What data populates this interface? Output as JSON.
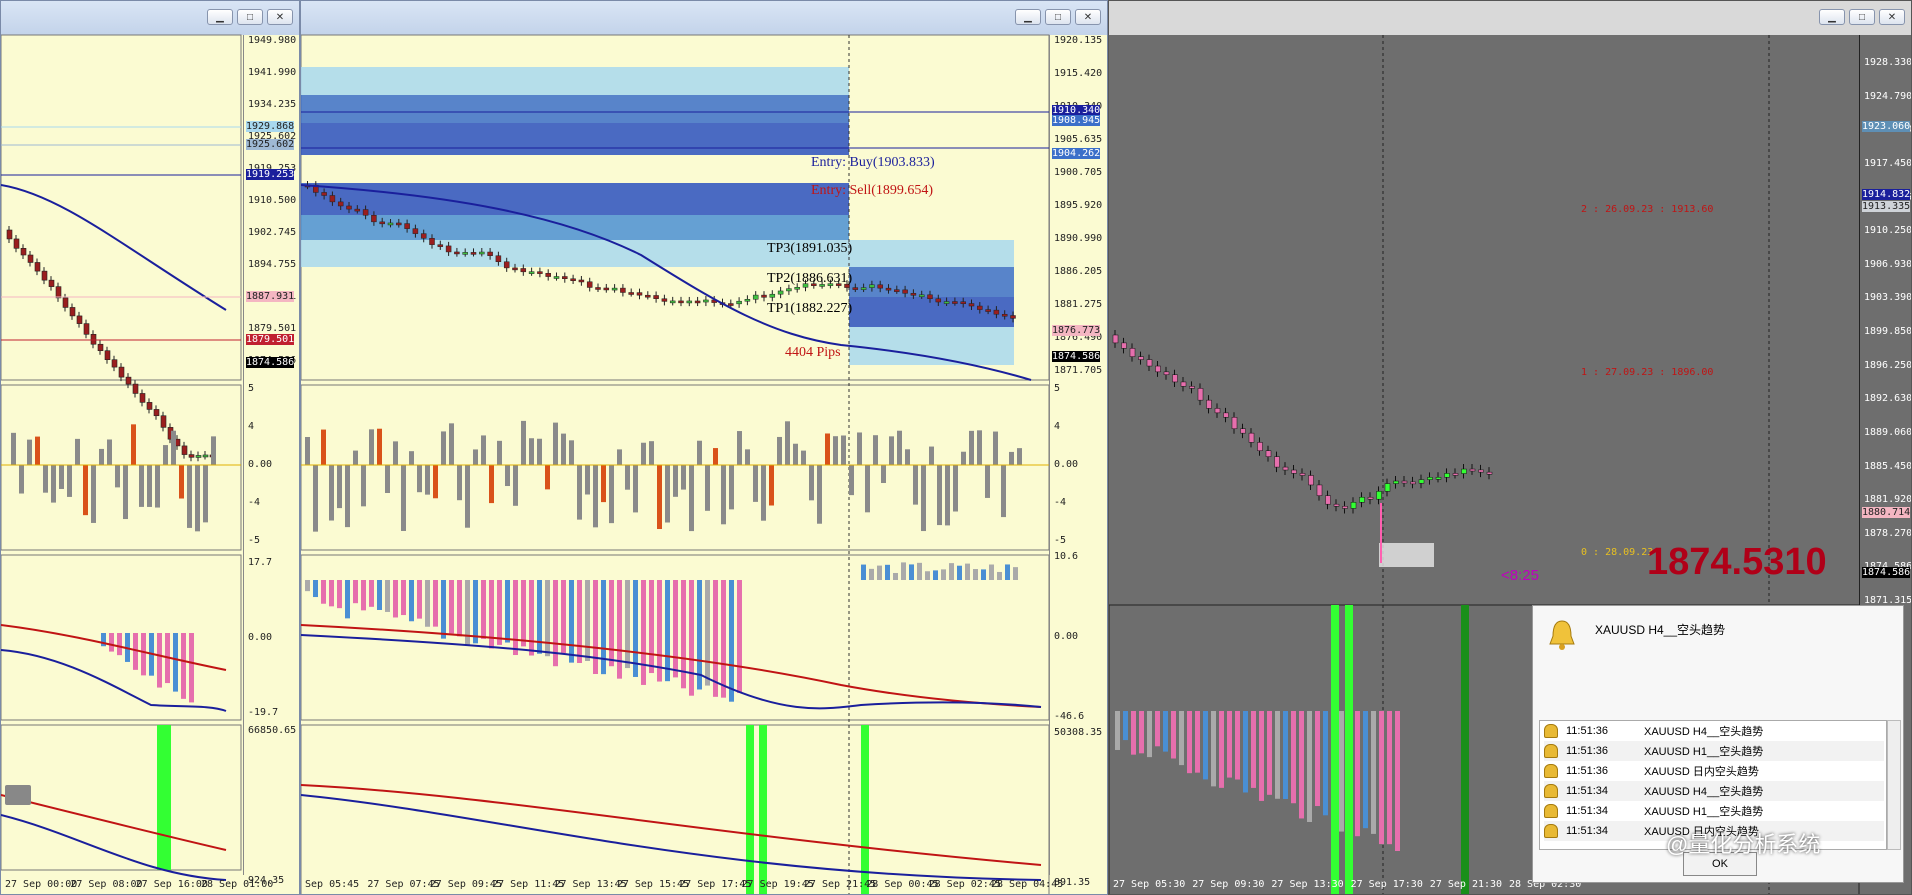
{
  "left_window": {
    "main_axis": [
      "1949.980",
      "1941.990",
      "1934.235",
      "1925.602",
      "1919.253",
      "1910.500",
      "1902.745",
      "1894.755",
      "1887.931",
      "1879.501",
      "1874.586"
    ],
    "osc_axis": [
      "5",
      "4",
      "0.00",
      "-4",
      "-5"
    ],
    "macd_axis": [
      "17.7",
      "0.00",
      "-19.7"
    ],
    "vol_axis": [
      "66850.65",
      "924.35"
    ],
    "time_axis": [
      "27 Sep 00:00",
      "27 Sep 08:00",
      "27 Sep 16:00",
      "28 Sep 01:00"
    ],
    "price_tag": "1874.586",
    "tags": [
      {
        "label": "1929.868",
        "color": "#a8d8ef"
      },
      {
        "label": "1925.602",
        "color": "#9fb9d4"
      },
      {
        "label": "1919.253",
        "color": "#1a1f9c"
      },
      {
        "label": "1887.931",
        "color": "#f4b6c2"
      },
      {
        "label": "1879.501",
        "color": "#c02030"
      }
    ]
  },
  "middle_window": {
    "main_axis": [
      "1920.135",
      "1915.420",
      "1910.340",
      "1905.635",
      "1900.705",
      "1895.920",
      "1890.990",
      "1886.205",
      "1881.275",
      "1876.490",
      "1871.705"
    ],
    "osc_axis": [
      "5",
      "4",
      "0.00",
      "-4",
      "-5"
    ],
    "macd_axis": [
      "10.6",
      "0.00",
      "-46.6"
    ],
    "vol_axis": [
      "50308.35",
      "891.35"
    ],
    "time_axis": [
      "Sep 05:45",
      "27 Sep 07:45",
      "27 Sep 09:45",
      "27 Sep 11:45",
      "27 Sep 13:45",
      "27 Sep 15:45",
      "27 Sep 17:45",
      "27 Sep 19:45",
      "27 Sep 21:45",
      "28 Sep 00:45",
      "28 Sep 02:45",
      "28 Sep 04:45"
    ],
    "tags": [
      {
        "label": "1910.340",
        "color": "#1a1f9c"
      },
      {
        "label": "1908.945",
        "color": "#3b6fc9"
      },
      {
        "label": "1904.262",
        "color": "#3b6fc9"
      },
      {
        "label": "1876.773",
        "color": "#f4b6c2"
      },
      {
        "label": "1874.586",
        "color": "#000000"
      }
    ],
    "entry_buy": "Entry: Buy(1903.833)",
    "entry_sell": "Entry: Sell(1899.654)",
    "tp3": "TP3(1891.035)",
    "tp2": "TP2(1886.631)",
    "tp1": "TP1(1882.227)",
    "pips": "4404 Pips"
  },
  "right_window": {
    "main_axis": [
      "1928.330",
      "1924.790",
      "1921.250",
      "1917.450",
      "1913.335",
      "1910.250",
      "1906.930",
      "1903.390",
      "1899.850",
      "1896.250",
      "1892.630",
      "1889.060",
      "1885.450",
      "1881.920",
      "1878.270",
      "1874.586",
      "1871.315"
    ],
    "time_axis": [
      "27 Sep 05:30",
      "27 Sep 09:30",
      "27 Sep 13:30",
      "27 Sep 17:30",
      "27 Sep 21:30",
      "28 Sep 02:30"
    ],
    "tags": [
      {
        "label": "1923.060",
        "color": "#5e8fb5"
      },
      {
        "label": "1914.832",
        "color": "#1a1f9c"
      },
      {
        "label": "1913.335",
        "color": "#cfd3d8"
      },
      {
        "label": "1880.714",
        "color": "#f4b6c2"
      },
      {
        "label": "1874.586",
        "color": "#000000"
      }
    ],
    "level_2": "2 : 26.09.23 : 1913.60",
    "level_1": "1 : 27.09.23 : 1896.00",
    "level_0": "0 : 28.09.23",
    "big_price": "1874.5310",
    "countdown": "<8:25"
  },
  "alert": {
    "title": "XAUUSD  H4__空头趋势",
    "rows": [
      {
        "time": "11:51:36",
        "text": "XAUUSD  H4__空头趋势"
      },
      {
        "time": "11:51:36",
        "text": "XAUUSD  H1__空头趋势"
      },
      {
        "time": "11:51:36",
        "text": "XAUUSD  日内空头趋势"
      },
      {
        "time": "11:51:34",
        "text": "XAUUSD  H4__空头趋势"
      },
      {
        "time": "11:51:34",
        "text": "XAUUSD  H1__空头趋势"
      },
      {
        "time": "11:51:34",
        "text": "XAUUSD  日内空头趋势"
      }
    ],
    "ok": "OK"
  },
  "watermark": "@量化分析系统",
  "colors": {
    "chart_bg": "#fbfbd2",
    "dark_bg": "#6e6e6e",
    "ma_blue": "#1a1f9c",
    "ma_red": "#c01414",
    "pink": "#e66fad",
    "lime": "#33ff33"
  }
}
